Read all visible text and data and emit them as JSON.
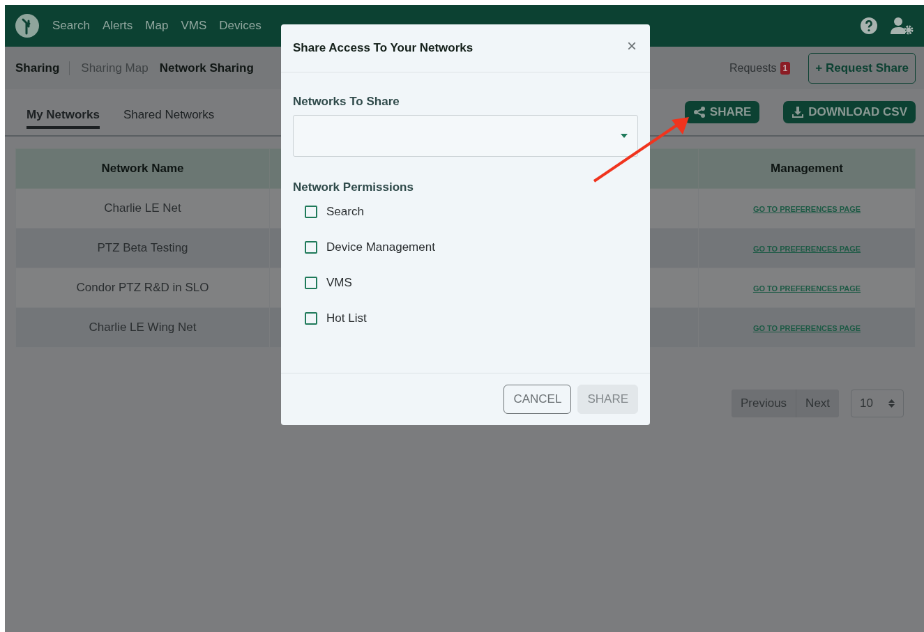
{
  "nav": {
    "items": [
      "Search",
      "Alerts",
      "Map",
      "VMS",
      "Devices"
    ]
  },
  "subnav": {
    "title": "Sharing",
    "items": [
      {
        "label": "Sharing Map",
        "selected": false
      },
      {
        "label": "Network Sharing",
        "selected": true
      }
    ],
    "requests": {
      "label": "Requests",
      "count": "1"
    },
    "request_button": "+ Request Share"
  },
  "tabs": [
    {
      "label": "My Networks",
      "selected": true
    },
    {
      "label": "Shared Networks",
      "selected": false
    }
  ],
  "actions": [
    {
      "kind": "share",
      "label": "SHARE"
    },
    {
      "kind": "download",
      "label": "DOWNLOAD CSV"
    }
  ],
  "table": {
    "columns": [
      "Network Name",
      "Management"
    ],
    "rows": [
      {
        "network_name": "Charlie LE Net",
        "management": "GO TO PREFERENCES PAGE"
      },
      {
        "network_name": "PTZ Beta Testing",
        "management": "GO TO PREFERENCES PAGE"
      },
      {
        "network_name": "Condor PTZ R&D in SLO",
        "management": "GO TO PREFERENCES PAGE"
      },
      {
        "network_name": "Charlie LE Wing Net",
        "management": "GO TO PREFERENCES PAGE"
      }
    ]
  },
  "pagination": {
    "previous": "Previous",
    "next": "Next",
    "page_size": "10"
  },
  "modal": {
    "title": "Share Access To Your Networks",
    "close": "×",
    "networks_label": "Networks To Share",
    "permissions_label": "Network Permissions",
    "permissions": [
      {
        "label": "Search",
        "checked": false
      },
      {
        "label": "Device Management",
        "checked": false
      },
      {
        "label": "VMS",
        "checked": false
      },
      {
        "label": "Hot List",
        "checked": false
      }
    ],
    "buttons": [
      {
        "kind": "cancel",
        "label": "CANCEL"
      },
      {
        "kind": "disabled",
        "label": "SHARE"
      }
    ]
  }
}
